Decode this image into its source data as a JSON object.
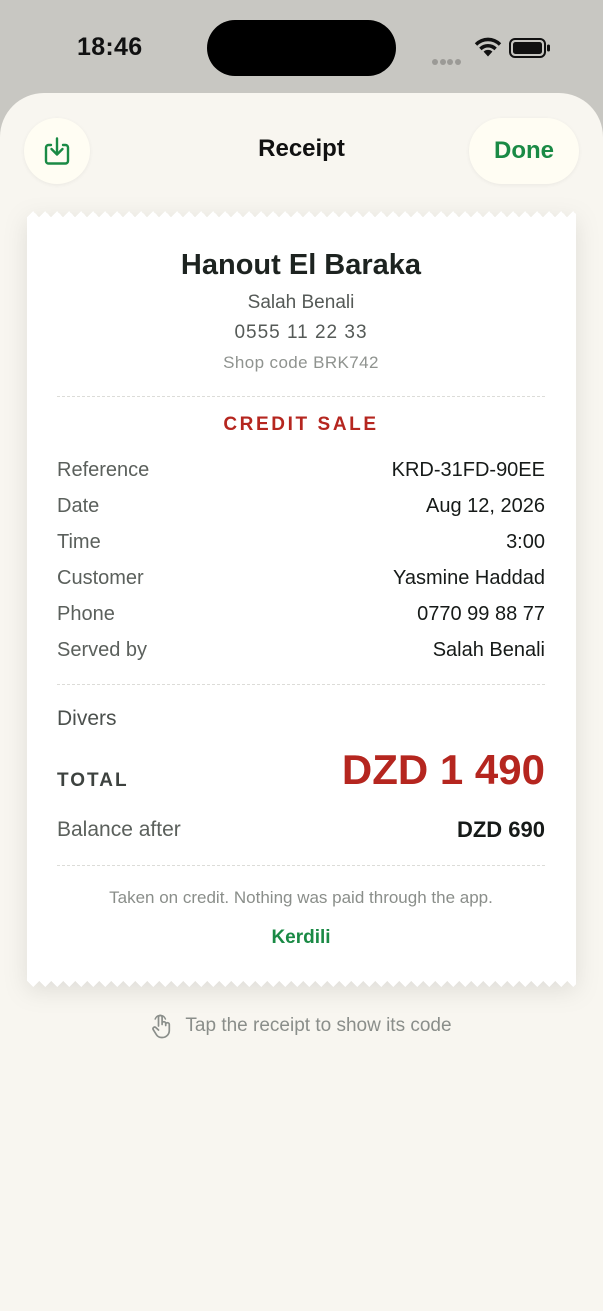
{
  "status": {
    "time": "18:46"
  },
  "header": {
    "title": "Receipt",
    "done_label": "Done"
  },
  "receipt": {
    "shop_name": "Hanout El Baraka",
    "owner": "Salah Benali",
    "phone": "0555 11 22 33",
    "shop_code": "Shop code BRK742",
    "sale_type": "CREDIT SALE",
    "details": [
      {
        "label": "Reference",
        "value": "KRD-31FD-90EE"
      },
      {
        "label": "Date",
        "value": "Aug 12, 2026"
      },
      {
        "label": "Time",
        "value": "3:00"
      },
      {
        "label": "Customer",
        "value": "Yasmine Haddad"
      },
      {
        "label": "Phone",
        "value": "0770 99 88 77"
      },
      {
        "label": "Served by",
        "value": "Salah Benali"
      }
    ],
    "item": "Divers",
    "total_label": "TOTAL",
    "total_value": "DZD 1 490",
    "balance_label": "Balance after",
    "balance_value": "DZD 690",
    "note": "Taken on credit. Nothing was paid through the app.",
    "brand": "Kerdili"
  },
  "hint": "Tap the receipt to show its code",
  "colors": {
    "accent_green": "#1a8a45",
    "accent_red": "#b5261f",
    "sheet_bg": "#f8f6f0"
  },
  "icons": {
    "download": "download-icon",
    "tap": "tap-hand-icon"
  }
}
